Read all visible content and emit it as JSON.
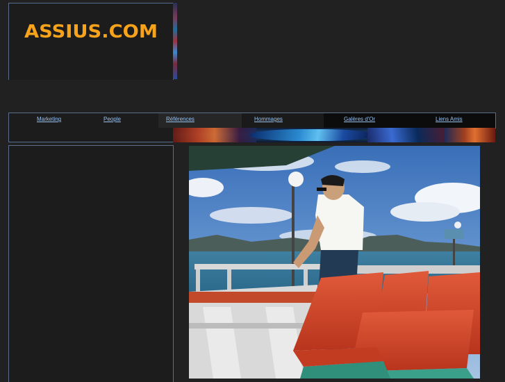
{
  "header": {
    "logo_text": "ASSIUS.COM"
  },
  "nav": {
    "items": [
      {
        "label": "Marketing"
      },
      {
        "label": "People"
      },
      {
        "label": "Références"
      },
      {
        "label": "Hommages"
      },
      {
        "label": "Galères d'Or"
      },
      {
        "label": "Liens Amis"
      }
    ]
  },
  "colors": {
    "page_background": "#212121",
    "logo": "#f6a31b",
    "link": "#9cc2ee",
    "border": "#5a6f8f"
  },
  "icons": [
    "photo-man-on-ferry"
  ]
}
